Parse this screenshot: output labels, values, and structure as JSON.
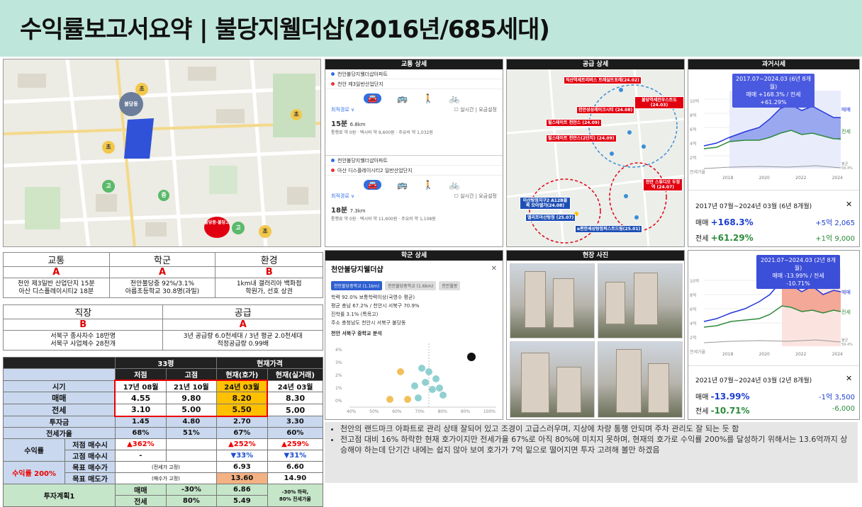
{
  "title": "수익률보고서요약 | 불당지웰더샵(2016년/685세대)",
  "map": {
    "pois": [
      "초",
      "불당동",
      "초",
      "초",
      "고",
      "중",
      "초",
      "고",
      "불당중·불당고"
    ],
    "icon": "district-map"
  },
  "grades": {
    "row1": [
      {
        "label": "교통",
        "grade": "A",
        "desc": "천안 제3일반 산업단지 15분\n아산 디스플레이시티2 18분"
      },
      {
        "label": "학군",
        "grade": "A",
        "desc": "천안불당중 92%/3.1%\n아름초등학교 30.8명(과밀)"
      },
      {
        "label": "환경",
        "grade": "B",
        "desc": "1km내 갤러리아 백화점\n학원가, 선호 상권"
      }
    ],
    "row2": [
      {
        "label": "직장",
        "grade": "B",
        "desc": "서북구 종사자수 18만명\n서북구 사업체수 28천개"
      },
      {
        "label": "공급",
        "grade": "A",
        "desc": "3년 공급량 6.0천세대 / 3년 평균 2.0천세대\n적정공급량 0.99배"
      }
    ]
  },
  "returns": {
    "size": "33평",
    "current_price": "현재가격",
    "cols": [
      "시기",
      "저점",
      "고점",
      "현재(호가)",
      "현재(실거래)"
    ],
    "period": [
      "17년 08월",
      "21년 10월",
      "24년 03월",
      "24년 03월"
    ],
    "sale": [
      "4.55",
      "9.80",
      "8.20",
      "8.30"
    ],
    "jeonse": [
      "3.10",
      "5.00",
      "5.50",
      "5.00"
    ],
    "invest": [
      "1.45",
      "4.80",
      "2.70",
      "3.30"
    ],
    "ratio": [
      "68%",
      "51%",
      "67%",
      "60%"
    ],
    "r_low_label": "저점 매수시",
    "r_low": [
      "▲362%",
      "▲252%",
      "▲259%"
    ],
    "r_high_label": "고점 매수시",
    "r_high": [
      "-",
      "▼33%",
      "▼31%"
    ],
    "target_sale_label": "목표 매수가",
    "target_sale": [
      "(전세가 고정)",
      "6.93",
      "6.60"
    ],
    "target_sell_label": "목표 매도가",
    "target_sell": [
      "(매수가 고정)",
      "13.60",
      "14.90"
    ],
    "labels": {
      "period": "시기",
      "sale": "매매",
      "jeonse": "전세",
      "invest": "투자금",
      "ratio": "전세가율",
      "return": "수익률",
      "return_target": "수익률 200%",
      "plan": "투자계획1"
    },
    "plan": {
      "sale_label": "매매",
      "sale": "-30%",
      "sale_v": "6.86",
      "jeonse_label": "전세",
      "jeonse": "80%",
      "jeonse_v": "5.49",
      "note": "-30% 하락,\n80% 전세가율"
    }
  },
  "traffic": {
    "header": "교통 상세",
    "routes": [
      {
        "from": "천안불당지웰더샵아파트",
        "to": "천안 제3일반산업단지",
        "time": "15분",
        "dist": "6.8km",
        "detail": "통행료 약 0원 · 택시비 약 9,600원 · 주유비 약 1,032원"
      },
      {
        "from": "천안불당지웰더샵아파트",
        "to": "아산 디스플레이시티2 일반산업단지",
        "time": "18분",
        "dist": "7.3km",
        "detail": "통행료 약 0원 · 택시비 약 11,600원 · 주유비 약 1,108원"
      }
    ],
    "opt_left": "최적경로 ∨",
    "opt_right": "☐ 실시간 | 요금설정"
  },
  "supply": {
    "header": "공급 상세",
    "labels": [
      "직산역세트리버스 트레실뜨포레(24.02)",
      "불당역세진우스트도 (24.03)",
      "천안성성레이크시티 (24.08)",
      "힐스테이트 천안스 (24.09)",
      "힐스테이트 천안스(2단지) (24.09)",
      "천안 스튜디오 두정역 (24.07)",
      "아산탕정지구2 A12B블록 모아엘가(24.08)",
      "엘리프아산탕정 (25.07)",
      "e편한세상탕정퍼스트드림(25.01)"
    ]
  },
  "past": {
    "header": "과거시세",
    "c1": {
      "popup1": "2017.07~2024.03 (6년 8개월)",
      "popup2": "매매 +168.3% / 전세 +61.29%",
      "range": "2017년 07월~2024년 03월 (6년 8개월)",
      "sale_pct": "+168.3%",
      "sale_abs": "+5억 2,065",
      "jeonse_pct": "+61.29%",
      "jeonse_abs": "+1억 9,000",
      "y": [
        "10억",
        "8억",
        "6억",
        "4억",
        "2억",
        "전세가율"
      ],
      "x": [
        "2018",
        "2020",
        "2022",
        "2024"
      ],
      "line_sale": "매매",
      "line_jeonse": "전세",
      "line_avg": "평균\n59.4%"
    },
    "c2": {
      "popup1": "2021.07~2024.03 (2년 8개월)",
      "popup2": "매매 -13.99% / 전세 -10.71%",
      "range": "2021년 07월~2024년 03월 (2년 8개월)",
      "sale_pct": "-13.99%",
      "sale_abs": "-1억 3,500",
      "jeonse_pct": "-10.71%",
      "jeonse_abs": "-6,000",
      "y": [
        "10억",
        "8억",
        "6억",
        "4억",
        "2억",
        "전세가율"
      ],
      "x": [
        "2018",
        "2020",
        "2022",
        "2024"
      ],
      "line_sale": "매매",
      "line_jeonse": "전세",
      "line_avg": "평균\n59.4%"
    },
    "sale_label": "매매",
    "jeonse_label": "전세",
    "close": "✕"
  },
  "school": {
    "header": "학군 상세",
    "name": "천안불당지웰더샵",
    "chips": [
      "천안불당중학교 (1.1km)",
      "천안불당중학교 (1.6km)",
      "천안월봉"
    ],
    "lines": [
      "학력 92.0% 보통학력이상(국영수 평균)",
      "평균 충남 67.2% / 천안시 서북구 70.9%",
      "진학률 3.1% (특목고)",
      "주소 충청남도 천안시 서북구 불당동"
    ],
    "chart_title": "천안 서북구 중학교 분석",
    "xticks": [
      "40%",
      "50%",
      "60%",
      "70%",
      "80%",
      "90%",
      "100%"
    ],
    "yticks": [
      "4%",
      "3%",
      "2%",
      "1%",
      "0%"
    ]
  },
  "photos": {
    "header": "현장 사진"
  },
  "notes": [
    "천안의 랜드마크 아파트로 관리 상태 잘되어 있고 조경이 고급스러우며, 지상에 차량 통행 안되며 주차 관리도 잘 되는 듯 함",
    "전고점 대비 16% 하락한 현재 호가이지만 전세가율 67%로 아직 80%에 미치지 못하며, 현재의 호가로 수익률 200%를 달성하기 위해서는 13.6억까지 상승해야 하는데 단기간 내에는 쉽지 않아 보여 호가가 7억 밑으로 떨어지면 투자 고려해 볼만 하겠음"
  ]
}
